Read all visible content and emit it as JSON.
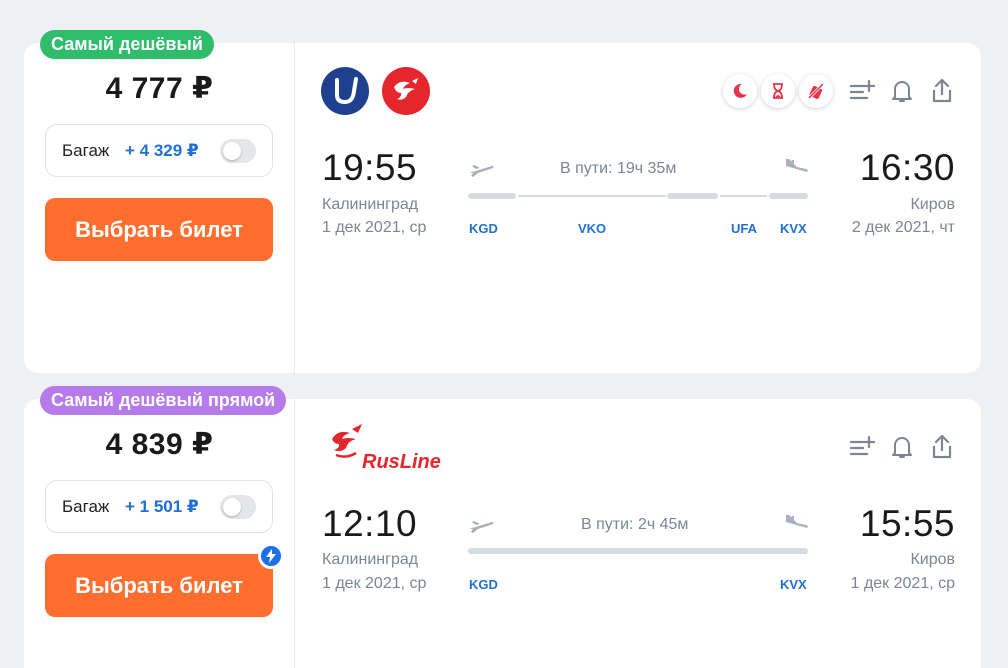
{
  "cards": [
    {
      "badge": "Самый дешёвый",
      "price": "4 777 ₽",
      "baggage_label": "Багаж",
      "baggage_price": "+ 4 329 ₽",
      "buy_label": "Выбрать билет",
      "airlines": [
        "UTair",
        "RusLine"
      ],
      "feature_icons": [
        "moon-icon",
        "hourglass-icon",
        "luggage-no-icon"
      ],
      "departure": {
        "time": "19:55",
        "city": "Калининград",
        "date": "1 дек 2021, ср",
        "iata": "KGD"
      },
      "arrival": {
        "time": "16:30",
        "city": "Киров",
        "date": "2 дек 2021, чт",
        "iata": "KVX"
      },
      "duration": "В пути: 19ч 35м",
      "stops": [
        "VKO",
        "UFA"
      ]
    },
    {
      "badge": "Самый дешёвый прямой",
      "price": "4 839 ₽",
      "baggage_label": "Багаж",
      "baggage_price": "+ 1 501 ₽",
      "buy_label": "Выбрать билет",
      "airline_logo_text": "RusLine",
      "departure": {
        "time": "12:10",
        "city": "Калининград",
        "date": "1 дек 2021, ср",
        "iata": "KGD"
      },
      "arrival": {
        "time": "15:55",
        "city": "Киров",
        "date": "1 дек 2021, ср",
        "iata": "KVX"
      },
      "duration": "В пути: 2ч 45м"
    }
  ],
  "colors": {
    "cheapest_badge": "#2fbd6b",
    "direct_badge": "#b67bea",
    "buy_button": "#ff6e2e",
    "accent_blue": "#1f6fd6"
  }
}
